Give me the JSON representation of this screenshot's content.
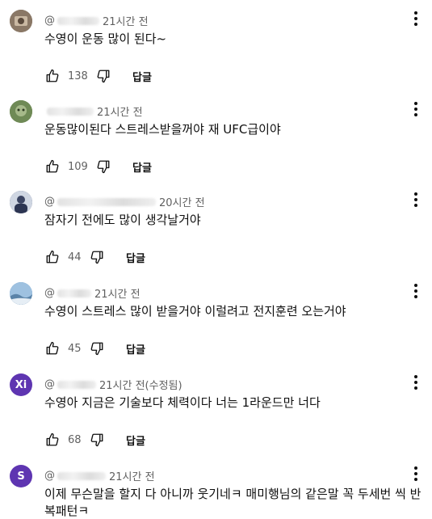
{
  "comments": [
    {
      "avatar_letter": "",
      "avatar_color": "#7a6a5a",
      "handle": "@",
      "handle_suffix": "l",
      "time": "21시간 전",
      "text": "수영이 운동 많이 된다~",
      "likes": "138",
      "reply_label": "답글"
    },
    {
      "avatar_letter": "",
      "avatar_color": "#5f7a4a",
      "handle": "",
      "handle_suffix": "",
      "time": "21시간 전",
      "text": "운동많이된다 스트레스받을꺼야 재 UFC급이야",
      "likes": "109",
      "reply_label": "답글"
    },
    {
      "avatar_letter": "",
      "avatar_color": "#3f4a6e",
      "handle": "@",
      "handle_suffix": "",
      "time": "20시간 전",
      "text": "잠자기 전에도 많이 생각날거야",
      "likes": "44",
      "reply_label": "답글"
    },
    {
      "avatar_letter": "",
      "avatar_color": "#6f9bc4",
      "handle": "@",
      "handle_suffix": "",
      "time": "21시간 전",
      "text": "수영이 스트레스 많이 받을거야 이럴려고 전지훈련 오는거야",
      "likes": "45",
      "reply_label": "답글"
    },
    {
      "avatar_letter": "Xi",
      "avatar_color": "#5e35b1",
      "handle": "@",
      "handle_suffix": "",
      "time": "21시간 전(수정됨)",
      "text": "수영아 지금은 기술보다 체력이다 너는 1라운드만 너다",
      "likes": "68",
      "reply_label": "답글"
    },
    {
      "avatar_letter": "S",
      "avatar_color": "#5e35b1",
      "handle": "@",
      "handle_suffix": "",
      "time": "21시간 전",
      "text": "이제 무슨말을 할지 다 아니까 웃기네ㅋ 매미행님의 같은말 꼭 두세번 씩 반복패턴ㅋ",
      "likes": "",
      "reply_label": ""
    }
  ]
}
